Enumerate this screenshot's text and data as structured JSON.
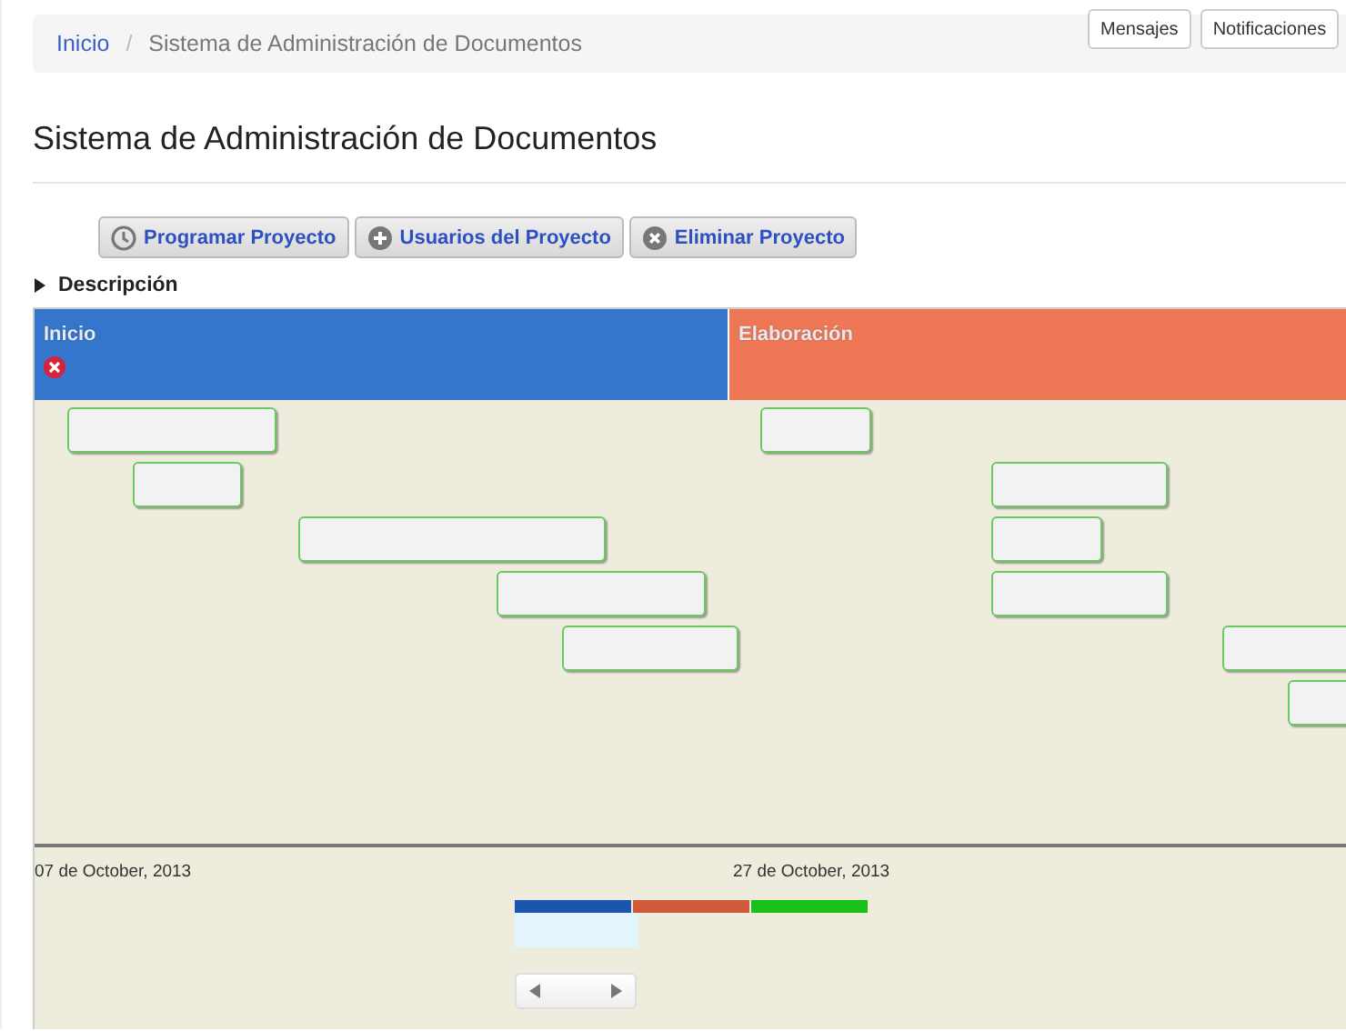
{
  "breadcrumb_separator": "/",
  "breadcrumb": [
    {
      "label": "Inicio",
      "link": true
    },
    {
      "label": "Sistema de Administración de Documentos",
      "link": false
    }
  ],
  "top_buttons": [
    "Mensajes",
    "Notificaciones"
  ],
  "title": "Sistema de Administración de Documentos",
  "actions": [
    {
      "label": "Programar Proyecto",
      "kind": "clock"
    },
    {
      "label": "Usuarios del Proyecto",
      "kind": "plus"
    },
    {
      "label": "Eliminar Proyecto",
      "kind": "remove"
    }
  ],
  "description": {
    "label": "Descripción",
    "expanded": false
  },
  "timeline": {
    "phases": [
      {
        "name": "Inicio",
        "color": "#3476cc",
        "closable": true
      },
      {
        "name": "Elaboración",
        "color": "#ee7856",
        "closable": false
      }
    ],
    "tasks": [
      {
        "kind": "task"
      },
      {
        "kind": "task"
      },
      {
        "kind": "task"
      },
      {
        "kind": "task"
      },
      {
        "kind": "task"
      },
      {
        "kind": "task"
      },
      {
        "kind": "task"
      },
      {
        "kind": "task"
      },
      {
        "kind": "task"
      },
      {
        "kind": "task"
      },
      {
        "kind": "task"
      }
    ],
    "axis_labels": [
      "07 de October, 2013",
      "27 de October, 2013"
    ],
    "overview": [
      {
        "color": "#1a56b0"
      },
      {
        "color": "#d05a38"
      },
      {
        "color": "#18c018"
      }
    ]
  }
}
